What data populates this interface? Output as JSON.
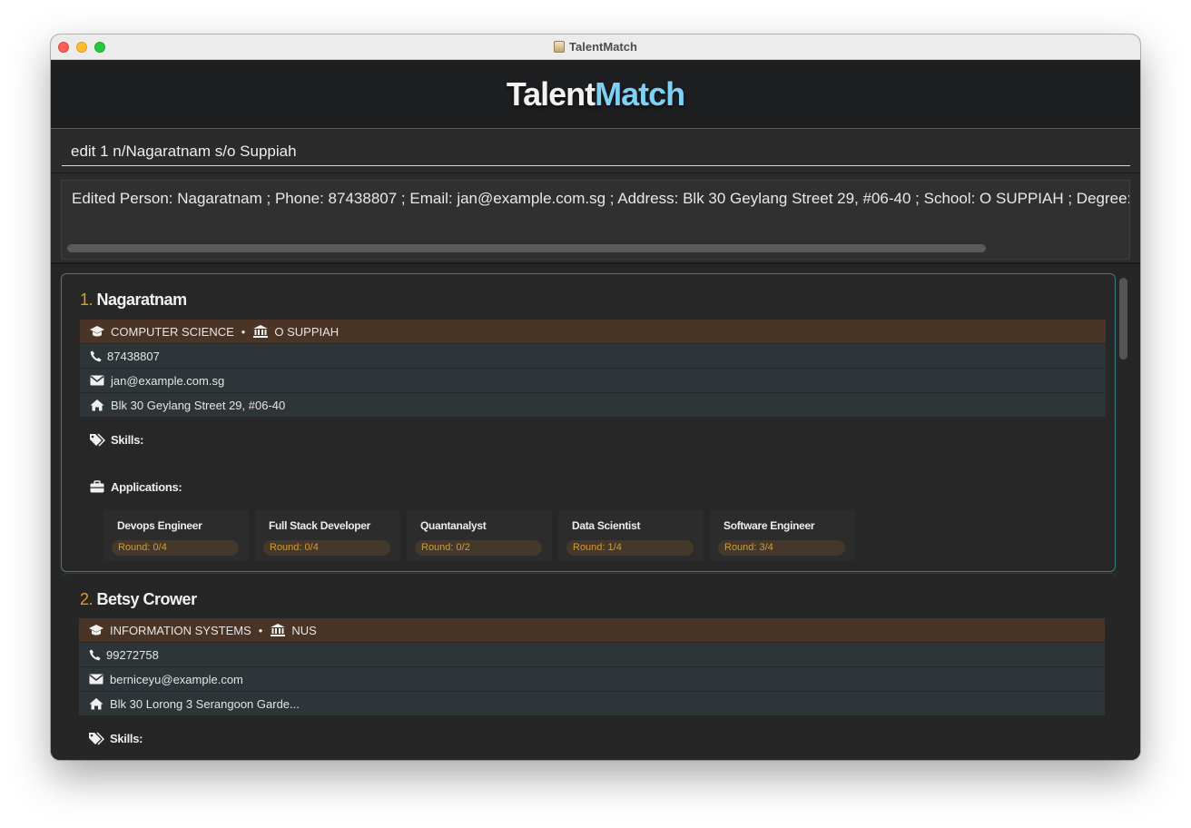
{
  "window": {
    "title": "TalentMatch"
  },
  "header": {
    "logo_part1": "Talent",
    "logo_part2": "Match"
  },
  "command": {
    "value": "edit 1 n/Nagaratnam s/o Suppiah"
  },
  "result": {
    "text": "Edited Person: Nagaratnam ; Phone: 87438807 ; Email: jan@example.com.sg ; Address: Blk 30 Geylang Street 29, #06-40 ; School: O SUPPIAH ; Degree: COMPUTER SCIENCE"
  },
  "labels": {
    "skills": "Skills:",
    "applications": "Applications:"
  },
  "persons": [
    {
      "index": "1.",
      "name": "Nagaratnam",
      "degree": "COMPUTER SCIENCE",
      "school": "O SUPPIAH",
      "phone": "87438807",
      "email": "jan@example.com.sg",
      "address": "Blk 30 Geylang Street 29, #06-40",
      "applications": [
        {
          "title": "Devops Engineer",
          "round": "Round: 0/4"
        },
        {
          "title": "Full Stack Developer",
          "round": "Round: 0/4"
        },
        {
          "title": "Quantanalyst",
          "round": "Round: 0/2"
        },
        {
          "title": "Data Scientist",
          "round": "Round: 1/4"
        },
        {
          "title": "Software Engineer",
          "round": "Round: 3/4"
        }
      ]
    },
    {
      "index": "2.",
      "name": "Betsy Crower",
      "degree": "INFORMATION SYSTEMS",
      "school": "NUS",
      "phone": "99272758",
      "email": "berniceyu@example.com",
      "address": "Blk 30 Lorong 3 Serangoon Garde..."
    }
  ],
  "colors": {
    "accent_blue": "#7fd0f5",
    "accent_orange": "#e39b1e",
    "edu_row": "#4a3426",
    "info_row": "#2d3538"
  }
}
